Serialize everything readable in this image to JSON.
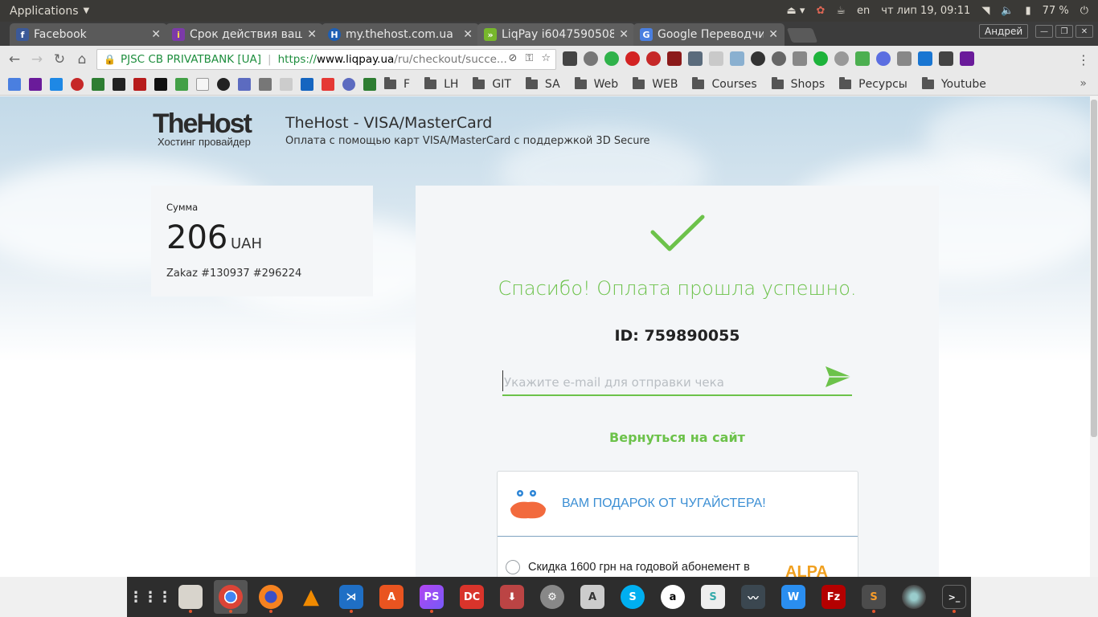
{
  "desktop": {
    "applications_label": "Applications",
    "lang": "en",
    "datetime": "чт лип 19, 09:11",
    "battery": "77 %"
  },
  "browser": {
    "tabs": [
      {
        "title": "Facebook",
        "color": "#3b5998",
        "glyph": "f"
      },
      {
        "title": "Срок действия ваш",
        "color": "#7c3aa8",
        "glyph": "i"
      },
      {
        "title": "my.thehost.com.ua",
        "color": "#1e5fb4",
        "glyph": "H"
      },
      {
        "title": "LiqPay i6047590508",
        "color": "#77b72c",
        "glyph": "»"
      },
      {
        "title": "Google Переводчи",
        "color": "#4a7fe0",
        "glyph": "G"
      }
    ],
    "profile_name": "Андрей",
    "security_label": "PJSC CB PRIVATBANK [UA]",
    "url_proto": "https://",
    "url_host": "www.liqpay.ua",
    "url_rest": "/ru/checkout/succe...",
    "bookmarks": [
      {
        "label": "F"
      },
      {
        "label": "LH"
      },
      {
        "label": "GIT"
      },
      {
        "label": "SA"
      },
      {
        "label": "Web"
      },
      {
        "label": "WEB"
      },
      {
        "label": "Courses"
      },
      {
        "label": "Shops"
      },
      {
        "label": "Ресурсы"
      },
      {
        "label": "Youtube"
      }
    ]
  },
  "page": {
    "brand_name": "TheHost",
    "brand_sub": "Хостинг провайдер",
    "merchant_title": "TheHost - VISA/MasterCard",
    "merchant_subtitle": "Оплата с помощью карт VISA/MasterCard с поддержкой 3D Secure",
    "amount_label": "Сумма",
    "amount_value": "206",
    "amount_currency": "UAH",
    "order_description": "Zakaz #130937 #296224",
    "success_message": "Спасибо! Оплата прошла успешно.",
    "payment_id": "ID: 759890055",
    "email_placeholder": "Укажите e-mail для отправки чека",
    "back_link": "Вернуться на сайт",
    "gift_title": "ВАМ ПОДАРОК ОТ ЧУГАЙСТЕРА!",
    "offer_text": "Скидка 1600 грн на годовой абонемент в",
    "offer_logo": "ALPA",
    "accent_color": "#6cc24a",
    "link_color": "#3c8fd4"
  }
}
